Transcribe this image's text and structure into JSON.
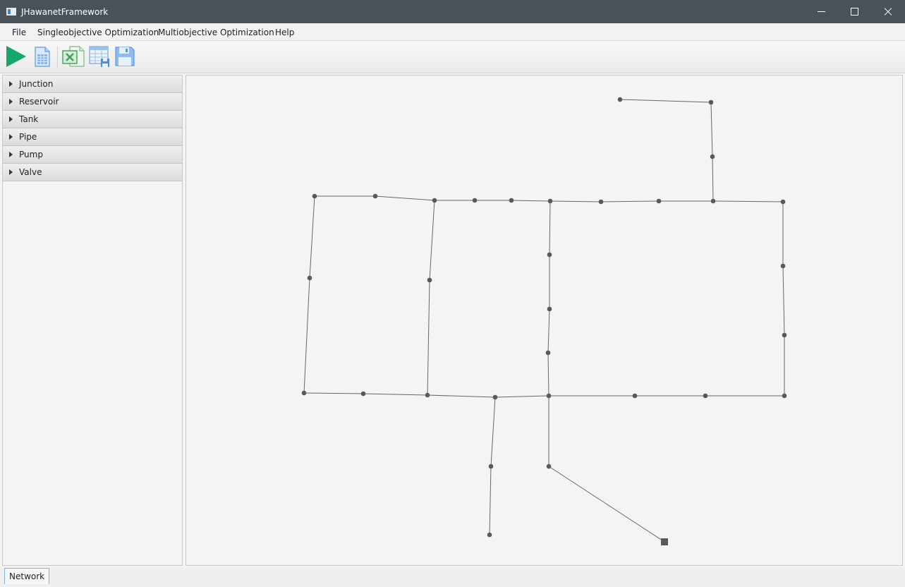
{
  "window": {
    "title": "JHawanetFramework"
  },
  "menu": [
    {
      "id": "file",
      "label": "File"
    },
    {
      "id": "single",
      "label": "Singleobjective Optimization"
    },
    {
      "id": "multi",
      "label": "Multiobjective Optimization"
    },
    {
      "id": "help",
      "label": "Help"
    }
  ],
  "toolbar": {
    "buttons": [
      {
        "name": "run-button",
        "icon": "play-icon",
        "color": "#14a66c"
      },
      {
        "name": "results-table-button",
        "icon": "spreadsheet-document-icon",
        "color": "#5a9be0"
      },
      {
        "name": "export-excel-button",
        "icon": "excel-icon",
        "color": "#3fa05a"
      },
      {
        "name": "table-save-button",
        "icon": "table-save-icon",
        "color": "#4a8fd6"
      },
      {
        "name": "save-button",
        "icon": "floppy-disk-icon",
        "color": "#5a9be0"
      }
    ]
  },
  "sidebar": {
    "items": [
      {
        "label": "Junction"
      },
      {
        "label": "Reservoir"
      },
      {
        "label": "Tank"
      },
      {
        "label": "Pipe"
      },
      {
        "label": "Pump"
      },
      {
        "label": "Valve"
      }
    ]
  },
  "tabs": [
    {
      "label": "Network",
      "active": true
    }
  ]
}
